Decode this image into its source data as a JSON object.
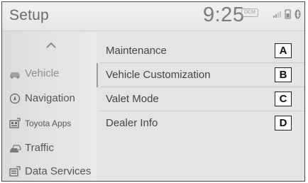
{
  "header": {
    "title": "Setup",
    "clock": "9:25",
    "status_badge": "DCM"
  },
  "sidebar": {
    "items": [
      {
        "label": "Vehicle",
        "icon": "car-icon",
        "active": true
      },
      {
        "label": "Navigation",
        "icon": "navigation-icon",
        "active": false
      },
      {
        "label": "Toyota Apps",
        "icon": "apps-icon",
        "active": false
      },
      {
        "label": "Traffic",
        "icon": "traffic-icon",
        "active": false
      },
      {
        "label": "Data Services",
        "icon": "data-services-icon",
        "active": false
      }
    ]
  },
  "menu": {
    "items": [
      {
        "label": "Maintenance",
        "callout": "A"
      },
      {
        "label": "Vehicle Customization",
        "callout": "B"
      },
      {
        "label": "Valet Mode",
        "callout": "C"
      },
      {
        "label": "Dealer Info",
        "callout": "D"
      }
    ]
  }
}
